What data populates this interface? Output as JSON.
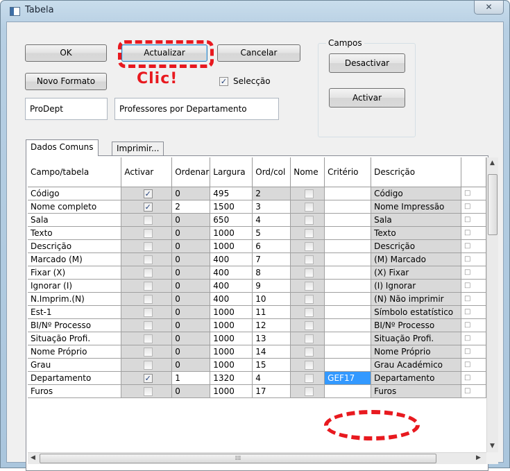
{
  "window": {
    "title": "Tabela",
    "close_symbol": "✕"
  },
  "buttons": {
    "ok": "OK",
    "actualizar": "Actualizar",
    "cancelar": "Cancelar",
    "novo_formato": "Novo Formato",
    "desactivar": "Desactivar",
    "activar": "Activar"
  },
  "campos_group": {
    "label": "Campos"
  },
  "seleccao": {
    "label": "Selecção",
    "checked": true
  },
  "fields": {
    "code": "ProDept",
    "description": "Professores por Departamento"
  },
  "annotation": {
    "clic": "Clic!"
  },
  "tabs": [
    "Dados Comuns",
    "Imprimir..."
  ],
  "grid": {
    "columns": [
      "Campo/tabela",
      "Activar",
      "Ordenar",
      "Largura",
      "Ord/col",
      "Nome",
      "Critério",
      "Descrição"
    ],
    "rows": [
      {
        "campo": "Código",
        "activar": true,
        "ordenar": "0",
        "largura": "495",
        "ordcol": "2",
        "criterio": "",
        "descricao": "Código"
      },
      {
        "campo": "Nome completo",
        "activar": true,
        "ordenar": "2",
        "largura": "1500",
        "ordcol": "3",
        "criterio": "",
        "descricao": "Nome Impressão"
      },
      {
        "campo": "Sala",
        "activar": false,
        "ordenar": "0",
        "largura": "650",
        "ordcol": "4",
        "criterio": "",
        "descricao": "Sala"
      },
      {
        "campo": "Texto",
        "activar": false,
        "ordenar": "0",
        "largura": "1000",
        "ordcol": "5",
        "criterio": "",
        "descricao": "Texto"
      },
      {
        "campo": "Descrição",
        "activar": false,
        "ordenar": "0",
        "largura": "1000",
        "ordcol": "6",
        "criterio": "",
        "descricao": "Descrição"
      },
      {
        "campo": "Marcado (M)",
        "activar": false,
        "ordenar": "0",
        "largura": "400",
        "ordcol": "7",
        "criterio": "",
        "descricao": "(M) Marcado"
      },
      {
        "campo": "Fixar (X)",
        "activar": false,
        "ordenar": "0",
        "largura": "400",
        "ordcol": "8",
        "criterio": "",
        "descricao": "(X) Fixar"
      },
      {
        "campo": "Ignorar (I)",
        "activar": false,
        "ordenar": "0",
        "largura": "400",
        "ordcol": "9",
        "criterio": "",
        "descricao": "(I) Ignorar"
      },
      {
        "campo": "N.Imprim.(N)",
        "activar": false,
        "ordenar": "0",
        "largura": "400",
        "ordcol": "10",
        "criterio": "",
        "descricao": "(N) Não imprimir"
      },
      {
        "campo": "Est-1",
        "activar": false,
        "ordenar": "0",
        "largura": "1000",
        "ordcol": "11",
        "criterio": "",
        "descricao": "Símbolo estatístico"
      },
      {
        "campo": "BI/Nº Processo",
        "activar": false,
        "ordenar": "0",
        "largura": "1000",
        "ordcol": "12",
        "criterio": "",
        "descricao": "BI/Nº Processo"
      },
      {
        "campo": "Situação Profi.",
        "activar": false,
        "ordenar": "0",
        "largura": "1000",
        "ordcol": "13",
        "criterio": "",
        "descricao": "Situação Profi."
      },
      {
        "campo": "Nome Próprio",
        "activar": false,
        "ordenar": "0",
        "largura": "1000",
        "ordcol": "14",
        "criterio": "",
        "descricao": "Nome Próprio"
      },
      {
        "campo": "Grau",
        "activar": false,
        "ordenar": "0",
        "largura": "1000",
        "ordcol": "15",
        "criterio": "",
        "descricao": "Grau Académico"
      },
      {
        "campo": "Departamento",
        "activar": true,
        "ordenar": "1",
        "largura": "1320",
        "ordcol": "4",
        "criterio": "GEF17",
        "descricao": "Departamento"
      },
      {
        "campo": "Furos",
        "activar": false,
        "ordenar": "0",
        "largura": "1000",
        "ordcol": "17",
        "criterio": "",
        "descricao": "Furos"
      }
    ]
  },
  "colors": {
    "selection": "#3399ff",
    "annotation_red": "#e8191f",
    "disabled_cell": "#d9d9d9"
  },
  "icons": [
    "close-icon",
    "checkbox-checked-icon",
    "scroll-up-arrow-icon",
    "scroll-down-arrow-icon",
    "scroll-left-arrow-icon",
    "scroll-right-arrow-icon"
  ]
}
